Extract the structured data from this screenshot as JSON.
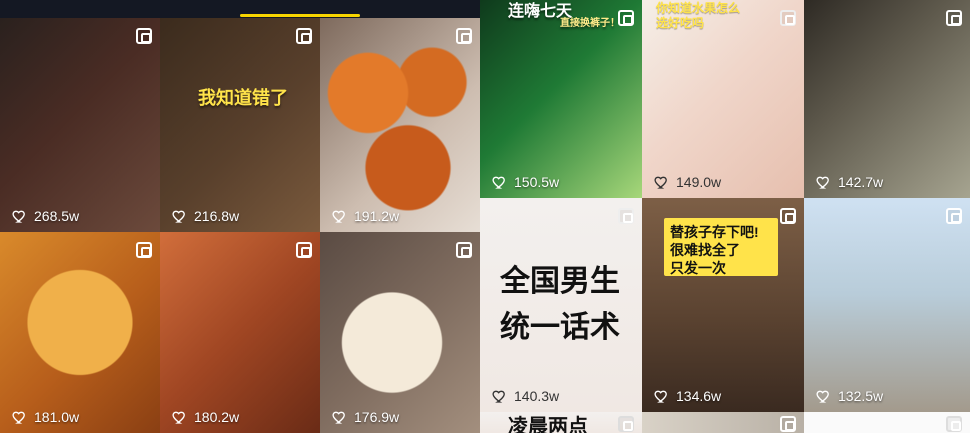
{
  "tiles": [
    {
      "likes": "268.5w",
      "caption": ""
    },
    {
      "likes": "216.8w",
      "caption": "我知道错了"
    },
    {
      "likes": "191.2w",
      "caption": ""
    },
    {
      "likes": "181.0w",
      "caption": ""
    },
    {
      "likes": "180.2w",
      "caption": ""
    },
    {
      "likes": "176.9w",
      "caption": ""
    },
    {
      "likes": "150.5w",
      "caption": "连嗨七天",
      "subcaption": "直接换裤子！"
    },
    {
      "likes": "149.0w",
      "caption": "你知道水果怎么",
      "caption2": "选好吃吗"
    },
    {
      "likes": "142.7w",
      "caption": ""
    },
    {
      "likes": "140.3w",
      "caption": "全国男生",
      "caption2": "统一话术"
    },
    {
      "likes": "134.6w",
      "caption": "替孩子存下吧!",
      "caption2": "很难找全了",
      "caption3": "只发一次"
    },
    {
      "likes": "132.5w",
      "caption": ""
    },
    {
      "likes": "",
      "caption": "凌晨两点"
    }
  ],
  "colors": {
    "accent_underline": "#f7d400",
    "yellow_caption": "#ffe34a"
  },
  "icons": {
    "likes": "heart-icon",
    "multi": "multi-image-icon"
  }
}
